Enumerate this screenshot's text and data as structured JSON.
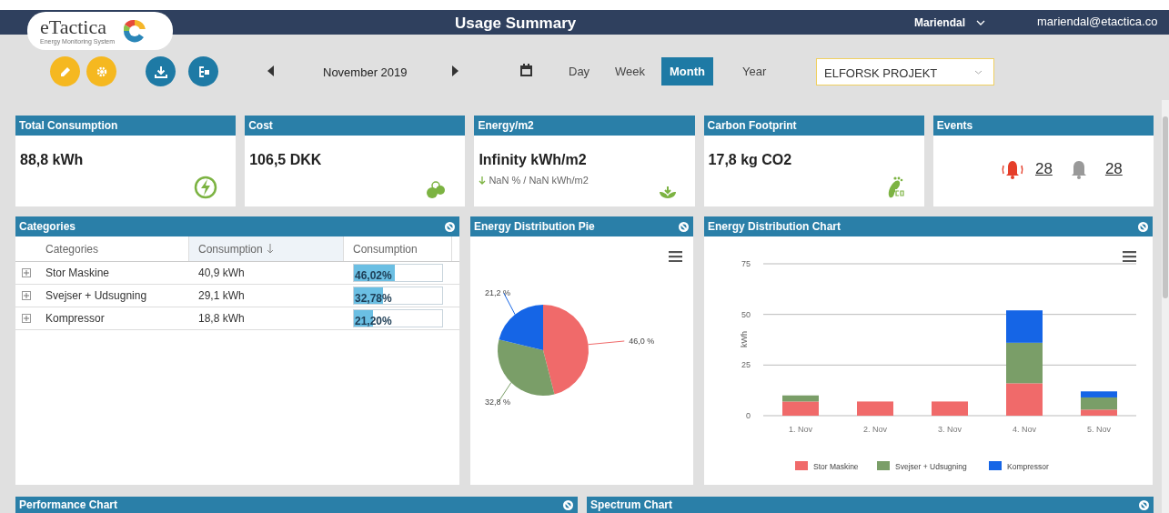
{
  "header": {
    "title": "Usage Summary",
    "site": "Mariendal",
    "user": "mariendal@etactica.co"
  },
  "logo": {
    "name": "eTactica",
    "tagline": "Energy Monitoring System"
  },
  "toolbar": {
    "period": "November 2019",
    "project": "ELFORSK PROJEKT",
    "ranges": [
      {
        "label": "Day",
        "selected": false
      },
      {
        "label": "Week",
        "selected": false
      },
      {
        "label": "Month",
        "selected": true
      },
      {
        "label": "Year",
        "selected": false
      }
    ]
  },
  "cards": [
    {
      "kind": "value",
      "title": "Total Consumption",
      "value": "88,8 kWh"
    },
    {
      "kind": "value",
      "title": "Cost",
      "value": "106,5 DKK"
    },
    {
      "kind": "value",
      "title": "Energy/m2",
      "value": "Infinity kWh/m2",
      "sub": "NaN % / NaN kWh/m2"
    },
    {
      "kind": "value",
      "title": "Carbon Footprint",
      "value": "17,8 kg CO2"
    },
    {
      "kind": "events",
      "title": "Events",
      "alarms": "28",
      "notices": "28"
    }
  ],
  "categories": {
    "title": "Categories",
    "columns": [
      {
        "label": "Categories",
        "sorted": false
      },
      {
        "label": "Consumption",
        "sorted": true
      },
      {
        "label": "Consumption",
        "sorted": false
      }
    ],
    "rows": [
      {
        "name": "Stor Maskine",
        "value": "40,9 kWh",
        "share": "46,02%",
        "level": 0.4602,
        "expanded": false
      },
      {
        "name": "Svejser + Udsugning",
        "value": "29,1 kWh",
        "share": "32,78%",
        "level": 0.3278,
        "expanded": false
      },
      {
        "name": "Kompressor",
        "value": "18,8 kWh",
        "share": "21,20%",
        "level": 0.212,
        "expanded": false
      }
    ]
  },
  "pie": {
    "title": "Energy Distribution Pie",
    "chart_data": {
      "type": "pie",
      "values": [
        46.0,
        32.8,
        21.2
      ],
      "colors": [
        "#f06a6a",
        "#7a9e68",
        "#1565e6"
      ],
      "value_labels": [
        "46,0 %",
        "32,8 %",
        "21,2 %"
      ]
    }
  },
  "bars": {
    "title": "Energy Distribution Chart",
    "chart_data": {
      "type": "bar",
      "stacked": true,
      "legend": "bottom",
      "ylabel": "kWh",
      "categories": [
        "1. Nov",
        "2. Nov",
        "3. Nov",
        "4. Nov",
        "5. Nov"
      ],
      "ylim": [
        0,
        75
      ],
      "yticks": [
        0,
        25,
        50,
        75
      ],
      "series": [
        {
          "name": "Stor Maskine",
          "color": "#f06a6a",
          "values": [
            7,
            7,
            7,
            16,
            3
          ]
        },
        {
          "name": "Svejser + Udsugning",
          "color": "#7a9e68",
          "values": [
            3,
            0,
            0,
            20,
            6
          ]
        },
        {
          "name": "Kompressor",
          "color": "#1565e6",
          "values": [
            0,
            0,
            0,
            16,
            3
          ]
        }
      ]
    }
  },
  "bottom_panels": [
    {
      "title": "Performance Chart"
    },
    {
      "title": "Spectrum Chart"
    }
  ]
}
